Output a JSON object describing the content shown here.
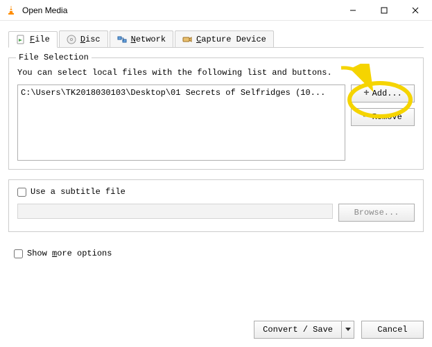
{
  "window": {
    "title": "Open Media"
  },
  "tabs": {
    "file": "File",
    "disc": "Disc",
    "network": "Network",
    "capture": "Capture Device"
  },
  "file_selection": {
    "legend": "File Selection",
    "hint": "You can select local files with the following list and buttons.",
    "items": [
      "C:\\Users\\TK2018030103\\Desktop\\01 Secrets of Selfridges (10..."
    ],
    "add_label": "Add...",
    "remove_label": "Remove"
  },
  "subtitle": {
    "checkbox_label": "Use a subtitle file",
    "browse_label": "Browse..."
  },
  "show_more_label": "Show more options",
  "convert_label": "Convert / Save",
  "cancel_label": "Cancel"
}
